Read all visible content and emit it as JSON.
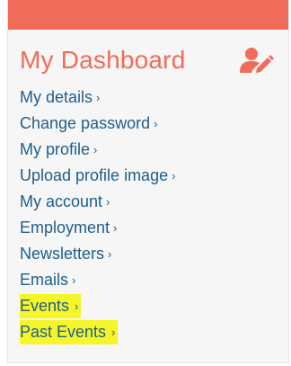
{
  "dashboard": {
    "title": "My Dashboard",
    "accent_color": "#f26b59",
    "link_color": "#1f5e8a",
    "highlight_color": "#f5f52a",
    "header_icon": "user-edit-icon"
  },
  "menu": [
    {
      "label": "My details",
      "chevron": "›",
      "highlighted": false
    },
    {
      "label": "Change password",
      "chevron": "›",
      "highlighted": false
    },
    {
      "label": "My profile",
      "chevron": "›",
      "highlighted": false
    },
    {
      "label": "Upload profile image",
      "chevron": "›",
      "highlighted": false
    },
    {
      "label": "My account",
      "chevron": "›",
      "highlighted": false
    },
    {
      "label": "Employment",
      "chevron": "›",
      "highlighted": false
    },
    {
      "label": "Newsletters",
      "chevron": "›",
      "highlighted": false
    },
    {
      "label": "Emails",
      "chevron": "›",
      "highlighted": false
    },
    {
      "label": "Events",
      "chevron": "›",
      "highlighted": true
    },
    {
      "label": "Past Events",
      "chevron": "›",
      "highlighted": true
    }
  ]
}
